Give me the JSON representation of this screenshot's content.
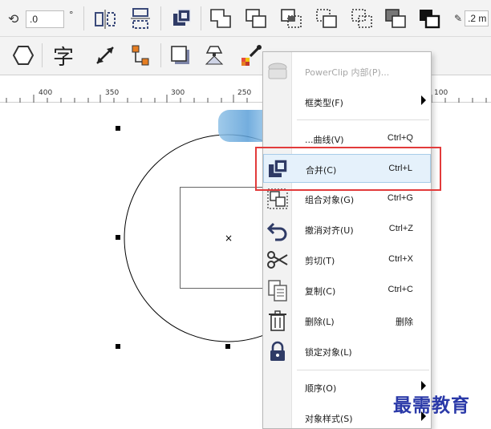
{
  "toolbar1": {
    "rotation_icon": "rotate-icon",
    "rotation_value": ".0",
    "degree_symbol": "°",
    "outline_width": ".2 m",
    "buttons": [
      "mirror-horizontal-icon",
      "mirror-vertical-icon",
      "combine-icon",
      "weld-icon",
      "trim-icon",
      "intersect-icon",
      "simplify-icon",
      "front-minus-back-icon",
      "back-minus-front-icon",
      "create-boundary-icon"
    ]
  },
  "toolbar2": {
    "buttons": [
      "convert-to-curves-icon",
      "text-icon",
      "dimension-icon",
      "connector-icon",
      "drop-shadow-icon",
      "transparency-icon",
      "eyedropper-icon",
      "paint-bucket-icon",
      "interactive-fill-icon",
      "envelope-icon",
      "add-icon"
    ],
    "text_glyph": "字"
  },
  "ruler": {
    "labels": [
      "400",
      "350",
      "300",
      "250",
      "100"
    ]
  },
  "canvas": {
    "center_mark": "×"
  },
  "context_menu": {
    "items": [
      {
        "label": "PowerClip 内部(P)...",
        "icon": "powerclip-icon",
        "disabled": true
      },
      {
        "label": "框类型(F)",
        "submenu": true
      },
      {
        "label": "...曲线(V)",
        "shortcut": "Ctrl+Q",
        "icon": "convert-curve-icon"
      },
      {
        "label": "合并(C)",
        "shortcut": "Ctrl+L",
        "icon": "combine-icon",
        "highlighted": true
      },
      {
        "label": "组合对象(G)",
        "shortcut": "Ctrl+G",
        "icon": "group-icon"
      },
      {
        "label": "撤消对齐(U)",
        "shortcut": "Ctrl+Z",
        "icon": "undo-icon"
      },
      {
        "label": "剪切(T)",
        "shortcut": "Ctrl+X",
        "icon": "scissors-icon"
      },
      {
        "label": "复制(C)",
        "shortcut": "Ctrl+C",
        "icon": "copy-icon"
      },
      {
        "label": "删除(L)",
        "shortcut": "删除",
        "icon": "trash-icon"
      },
      {
        "label": "锁定对象(L)",
        "icon": "lock-icon"
      },
      {
        "label": "顺序(O)",
        "submenu": true
      },
      {
        "label": "对象样式(S)",
        "submenu": true
      }
    ]
  },
  "watermark": "最需教育",
  "colors": {
    "accent": "#e23b3b",
    "highlight_bg": "#e5f1fb",
    "icon_navy": "#2f3b66",
    "watermark": "#2a39a8"
  }
}
